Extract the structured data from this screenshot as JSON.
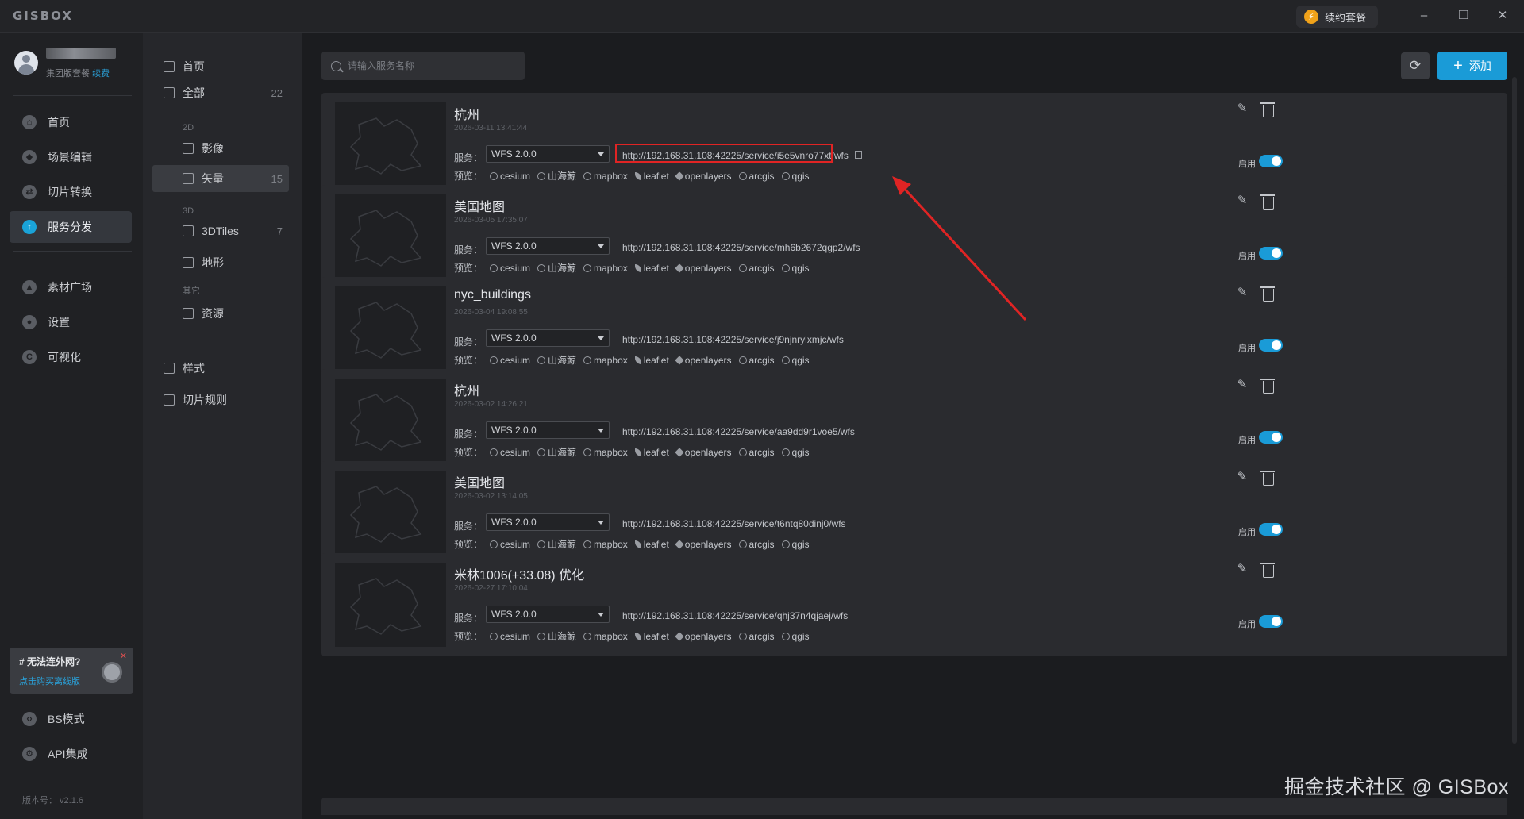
{
  "app": {
    "logo": "GISBOX"
  },
  "titlebar": {
    "renew_label": "续约套餐",
    "minimize": "–",
    "restore": "❐",
    "close": "✕"
  },
  "user": {
    "plan": "集团版套餐",
    "renew_link": "续费"
  },
  "sidebar": {
    "items": [
      {
        "label": "首页",
        "icon": "home-icon",
        "glyph": "⌂"
      },
      {
        "label": "场景编辑",
        "icon": "cube-icon",
        "glyph": "◆"
      },
      {
        "label": "切片转换",
        "icon": "convert-icon",
        "glyph": "⇄"
      },
      {
        "label": "服务分发",
        "icon": "cloud-upload-icon",
        "glyph": "↑"
      },
      {
        "label": "素材广场",
        "icon": "image-icon",
        "glyph": "▲"
      },
      {
        "label": "设置",
        "icon": "gear-icon",
        "glyph": "●"
      },
      {
        "label": "可视化",
        "icon": "visual-icon",
        "glyph": "C"
      }
    ],
    "active_index": 3,
    "offline_banner": {
      "title": "# 无法连外网?",
      "link": "点击购买离线版",
      "close": "✕"
    },
    "bottom_items": [
      {
        "label": "BS模式",
        "icon": "code-icon",
        "glyph": "‹›"
      },
      {
        "label": "API集成",
        "icon": "api-icon",
        "glyph": "⚙"
      }
    ],
    "version": "版本号： v2.1.6"
  },
  "subnav": {
    "home": "首页",
    "all": {
      "label": "全部",
      "count": "22"
    },
    "group_2d": "2D",
    "imagery": "影像",
    "vector": {
      "label": "矢量",
      "count": "15"
    },
    "group_3d": "3D",
    "tiles3d": {
      "label": "3DTiles",
      "count": "7"
    },
    "terrain": "地形",
    "group_other": "其它",
    "resource": "资源",
    "style": "样式",
    "tile_rules": "切片规则"
  },
  "toolbar": {
    "search_placeholder": "请输入服务名称",
    "refresh": "⟳",
    "add_label": "添加",
    "add_plus": "+"
  },
  "card_labels": {
    "service": "服务：",
    "preview": "预览：",
    "enable": "启用",
    "previews": [
      "cesium",
      "山海鲸",
      "mapbox",
      "leaflet",
      "openlayers",
      "arcgis",
      "qgis"
    ]
  },
  "services": [
    {
      "title": "杭州",
      "date": "2026-03-11 13:41:44",
      "version": "WFS 2.0.0",
      "url": "http://192.168.31.108:42225/service/i5e5vnro77xt/wfs",
      "enabled": true,
      "highlighted": true
    },
    {
      "title": "美国地图",
      "date": "2026-03-05 17:35:07",
      "version": "WFS 2.0.0",
      "url": "http://192.168.31.108:42225/service/mh6b2672qgp2/wfs",
      "enabled": true,
      "highlighted": false
    },
    {
      "title": "nyc_buildings",
      "date": "2026-03-04 19:08:55",
      "version": "WFS 2.0.0",
      "url": "http://192.168.31.108:42225/service/j9njnrylxmjc/wfs",
      "enabled": true,
      "highlighted": false
    },
    {
      "title": "杭州",
      "date": "2026-03-02 14:26:21",
      "version": "WFS 2.0.0",
      "url": "http://192.168.31.108:42225/service/aa9dd9r1voe5/wfs",
      "enabled": true,
      "highlighted": false
    },
    {
      "title": "美国地图",
      "date": "2026-03-02 13:14:05",
      "version": "WFS 2.0.0",
      "url": "http://192.168.31.108:42225/service/t6ntq80dinj0/wfs",
      "enabled": true,
      "highlighted": false
    },
    {
      "title": "米林1006(+33.08) 优化",
      "date": "2026-02-27 17:10:04",
      "version": "WFS 2.0.0",
      "url": "http://192.168.31.108:42225/service/qhj37n4qjaej/wfs",
      "enabled": true,
      "highlighted": false
    }
  ],
  "watermark": "掘金技术社区 @ GISBox",
  "colors": {
    "accent": "#1a9bd7",
    "highlight": "#e02424",
    "background": "#1b1c1f",
    "card": "#2a2b2f"
  }
}
